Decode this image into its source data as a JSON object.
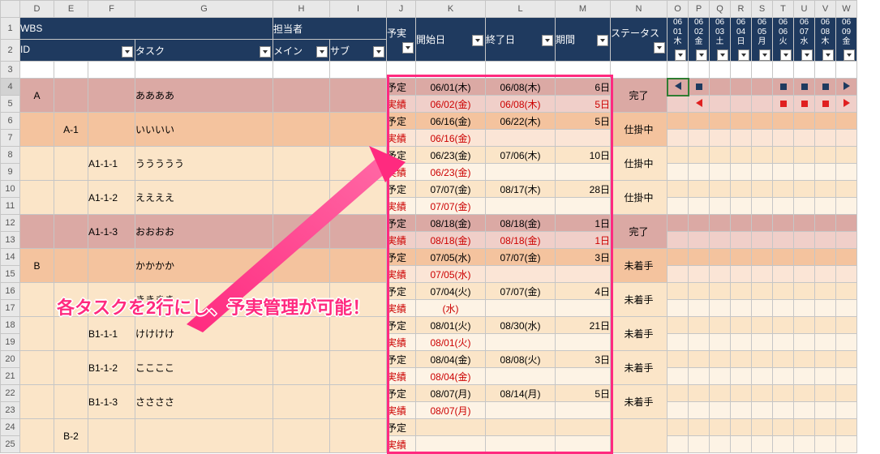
{
  "cols": [
    "D",
    "E",
    "F",
    "G",
    "H",
    "I",
    "J",
    "K",
    "L",
    "M",
    "N",
    "O",
    "P",
    "Q",
    "R",
    "S",
    "T",
    "U",
    "V",
    "W"
  ],
  "rows": [
    "1",
    "2",
    "3",
    "4",
    "5",
    "6",
    "7",
    "8",
    "9",
    "10",
    "11",
    "12",
    "13",
    "14",
    "15",
    "16",
    "17",
    "18",
    "19",
    "20",
    "21",
    "22",
    "23",
    "24",
    "25"
  ],
  "hdr1": {
    "wbs": "WBS",
    "assignee": "担当者",
    "pa": "予実",
    "start": "開始日",
    "end": "終了日",
    "duration": "期間",
    "status": "ステータス"
  },
  "hdr2": {
    "id": "ID",
    "task": "タスク",
    "main": "メイン",
    "sub": "サブ"
  },
  "dates": [
    {
      "m": "06",
      "d": "01",
      "w": "木"
    },
    {
      "m": "06",
      "d": "02",
      "w": "金"
    },
    {
      "m": "06",
      "d": "03",
      "w": "土"
    },
    {
      "m": "06",
      "d": "04",
      "w": "日"
    },
    {
      "m": "06",
      "d": "05",
      "w": "月"
    },
    {
      "m": "06",
      "d": "06",
      "w": "火"
    },
    {
      "m": "06",
      "d": "07",
      "w": "水"
    },
    {
      "m": "06",
      "d": "08",
      "w": "木"
    },
    {
      "m": "06",
      "d": "09",
      "w": "金"
    }
  ],
  "pa": {
    "plan": "予定",
    "actual": "実績"
  },
  "tasks": [
    {
      "id": "A",
      "idcol": 0,
      "task": "ああああ",
      "plan": {
        "start": "06/01(木)",
        "end": "06/08(木)",
        "dur": "6日"
      },
      "actual": {
        "start": "06/02(金)",
        "end": "06/08(木)",
        "dur": "5日"
      },
      "status": "完了",
      "bg": "pink",
      "markersPlan": [
        "tri-l",
        "sq-navy",
        "",
        "",
        "",
        "sq-navy",
        "sq-navy",
        "sq-navy",
        "tri-r-navy"
      ],
      "markersAct": [
        "",
        "tri-l-red",
        "",
        "",
        "",
        "sq-red",
        "sq-red",
        "sq-red",
        "tri-r-red"
      ]
    },
    {
      "id": "A-1",
      "idcol": 1,
      "task": "いいいい",
      "plan": {
        "start": "06/16(金)",
        "end": "06/22(木)",
        "dur": "5日"
      },
      "actual": {
        "start": "06/16(金)",
        "end": "",
        "dur": ""
      },
      "status": "仕掛中",
      "bg": "peach"
    },
    {
      "id": "A1-1-1",
      "idcol": 2,
      "task": "ううううう",
      "plan": {
        "start": "06/23(金)",
        "end": "07/06(木)",
        "dur": "10日"
      },
      "actual": {
        "start": "06/23(金)",
        "end": "",
        "dur": ""
      },
      "status": "仕掛中",
      "bg": "cream"
    },
    {
      "id": "A1-1-2",
      "idcol": 2,
      "task": "ええええ",
      "plan": {
        "start": "07/07(金)",
        "end": "08/17(木)",
        "dur": "28日"
      },
      "actual": {
        "start": "07/07(金)",
        "end": "",
        "dur": ""
      },
      "status": "仕掛中",
      "bg": "cream"
    },
    {
      "id": "A1-1-3",
      "idcol": 2,
      "task": "おおおお",
      "plan": {
        "start": "08/18(金)",
        "end": "08/18(金)",
        "dur": "1日"
      },
      "actual": {
        "start": "08/18(金)",
        "end": "08/18(金)",
        "dur": "1日"
      },
      "status": "完了",
      "bg": "pink"
    },
    {
      "id": "B",
      "idcol": 0,
      "task": "かかかか",
      "plan": {
        "start": "07/05(水)",
        "end": "07/07(金)",
        "dur": "3日"
      },
      "actual": {
        "start": "07/05(水)",
        "end": "",
        "dur": ""
      },
      "status": "未着手",
      "bg": "peach"
    },
    {
      "id": "",
      "idcol": 1,
      "task": "きききき",
      "plan": {
        "start": "07/04(火)",
        "end": "07/07(金)",
        "dur": "4日"
      },
      "actual": {
        "start": "(水)",
        "end": "",
        "dur": ""
      },
      "status": "未着手",
      "bg": "cream",
      "taskHidden": true
    },
    {
      "id": "B1-1-1",
      "idcol": 2,
      "task": "けけけけ",
      "plan": {
        "start": "08/01(火)",
        "end": "08/30(水)",
        "dur": "21日"
      },
      "actual": {
        "start": "08/01(火)",
        "end": "",
        "dur": ""
      },
      "status": "未着手",
      "bg": "cream"
    },
    {
      "id": "B1-1-2",
      "idcol": 2,
      "task": "ここここ",
      "plan": {
        "start": "08/04(金)",
        "end": "08/08(火)",
        "dur": "3日"
      },
      "actual": {
        "start": "08/04(金)",
        "end": "",
        "dur": ""
      },
      "status": "未着手",
      "bg": "cream"
    },
    {
      "id": "B1-1-3",
      "idcol": 2,
      "task": "ささささ",
      "plan": {
        "start": "08/07(月)",
        "end": "08/14(月)",
        "dur": "5日"
      },
      "actual": {
        "start": "08/07(月)",
        "end": "",
        "dur": ""
      },
      "status": "未着手",
      "bg": "cream"
    },
    {
      "id": "B-2",
      "idcol": 1,
      "task": "",
      "plan": {
        "start": "",
        "end": "",
        "dur": ""
      },
      "actual": {
        "start": "",
        "end": "",
        "dur": ""
      },
      "status": "",
      "bg": "cream"
    }
  ],
  "annotation": "各タスクを2行にし、予実管理が可能！",
  "colWidths": {
    "D": 42,
    "E": 42,
    "F": 58,
    "G": 170,
    "H": 70,
    "I": 70,
    "J": 36,
    "K": 86,
    "L": 86,
    "M": 68,
    "N": 70,
    "date": 26
  },
  "activeCell": "O4"
}
